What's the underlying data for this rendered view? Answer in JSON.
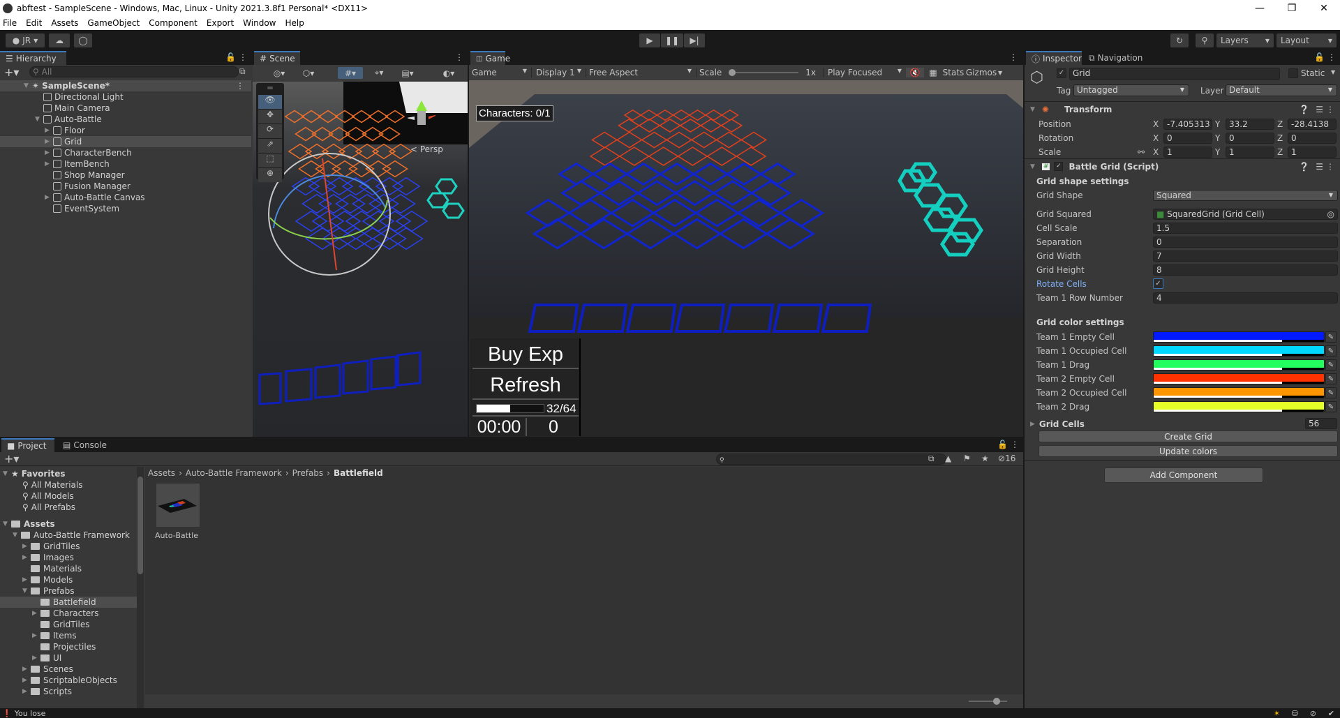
{
  "window": {
    "title": "abftest - SampleScene - Windows, Mac, Linux - Unity 2021.3.8f1 Personal* <DX11>",
    "controls": [
      "minimize",
      "maximize",
      "close"
    ]
  },
  "menu": [
    "File",
    "Edit",
    "Assets",
    "GameObject",
    "Component",
    "Export",
    "Window",
    "Help"
  ],
  "toolbar": {
    "account": "JR",
    "layers": "Layers",
    "layout": "Layout"
  },
  "hierarchy": {
    "tab": "Hierarchy",
    "search_placeholder": "All",
    "scene": "SampleScene*",
    "items": [
      {
        "label": "Directional Light",
        "depth": 1,
        "expand": false,
        "selected": false
      },
      {
        "label": "Main Camera",
        "depth": 1,
        "expand": false,
        "selected": false
      },
      {
        "label": "Auto-Battle",
        "depth": 1,
        "expand": "open",
        "selected": false
      },
      {
        "label": "Floor",
        "depth": 2,
        "expand": "closed",
        "selected": false
      },
      {
        "label": "Grid",
        "depth": 2,
        "expand": "closed",
        "selected": true
      },
      {
        "label": "CharacterBench",
        "depth": 2,
        "expand": "closed",
        "selected": false
      },
      {
        "label": "ItemBench",
        "depth": 2,
        "expand": "closed",
        "selected": false
      },
      {
        "label": "Shop Manager",
        "depth": 2,
        "expand": false,
        "selected": false
      },
      {
        "label": "Fusion Manager",
        "depth": 2,
        "expand": false,
        "selected": false
      },
      {
        "label": "Auto-Battle Canvas",
        "depth": 2,
        "expand": "closed",
        "selected": false
      },
      {
        "label": "EventSystem",
        "depth": 2,
        "expand": false,
        "selected": false
      }
    ]
  },
  "scene": {
    "tab": "Scene",
    "persp_label": "< Persp"
  },
  "game": {
    "tab": "Game",
    "mode": "Game",
    "display": "Display 1",
    "aspect": "Free Aspect",
    "scale_label": "Scale",
    "scale_value": "1x",
    "play_mode": "Play Focused",
    "stats": "Stats",
    "gizmos": "Gizmos",
    "characters": "Characters: 0/1",
    "buy_exp": "Buy Exp",
    "refresh": "Refresh",
    "exp_text": "32/64",
    "exp_fraction": 0.5,
    "timer": "00:00",
    "gold": "0"
  },
  "inspector": {
    "tabs": [
      "Inspector",
      "Navigation"
    ],
    "object_name": "Grid",
    "active": true,
    "static_label": "Static",
    "tag_label": "Tag",
    "tag": "Untagged",
    "layer_label": "Layer",
    "layer": "Default",
    "transform": {
      "title": "Transform",
      "rows": [
        {
          "label": "Position",
          "x": "-7.405313",
          "y": "33.2",
          "z": "-28.4138"
        },
        {
          "label": "Rotation",
          "x": "0",
          "y": "0",
          "z": "0"
        },
        {
          "label": "Scale",
          "x": "1",
          "y": "1",
          "z": "1"
        }
      ]
    },
    "script": {
      "title": "Battle Grid (Script)",
      "shape_header": "Grid shape settings",
      "fields": [
        {
          "label": "Grid Shape",
          "value": "Squared",
          "kind": "dropdown"
        },
        {
          "label": "Grid Squared",
          "value": "SquaredGrid (Grid Cell)",
          "kind": "object"
        },
        {
          "label": "Cell Scale",
          "value": "1.5",
          "kind": "text"
        },
        {
          "label": "Separation",
          "value": "0",
          "kind": "text"
        },
        {
          "label": "Grid Width",
          "value": "7",
          "kind": "text"
        },
        {
          "label": "Grid Height",
          "value": "8",
          "kind": "text"
        },
        {
          "label": "Rotate Cells",
          "value": "true",
          "kind": "checkbox"
        },
        {
          "label": "Team 1 Row Number",
          "value": "4",
          "kind": "text"
        }
      ],
      "color_header": "Grid color settings",
      "colors": [
        {
          "label": "Team 1 Empty Cell",
          "color": "#0019ff"
        },
        {
          "label": "Team 1 Occupied Cell",
          "color": "#00d8ff"
        },
        {
          "label": "Team 1 Drag",
          "color": "#22ff5e"
        },
        {
          "label": "Team 2 Empty Cell",
          "color": "#ff3200"
        },
        {
          "label": "Team 2 Occupied Cell",
          "color": "#ff9600"
        },
        {
          "label": "Team 2 Drag",
          "color": "#e5ff28"
        }
      ],
      "grid_cells_label": "Grid Cells",
      "grid_cells_count": "56",
      "create_grid": "Create Grid",
      "update_colors": "Update colors"
    },
    "add_component": "Add Component"
  },
  "project": {
    "tabs": [
      "Project",
      "Console"
    ],
    "hidden_count": "16",
    "favorites": {
      "label": "Favorites",
      "items": [
        "All Materials",
        "All Models",
        "All Prefabs"
      ]
    },
    "assets_label": "Assets",
    "tree": [
      {
        "label": "Auto-Battle Framework",
        "depth": 1,
        "expand": "open",
        "selected": false
      },
      {
        "label": "GridTiles",
        "depth": 2,
        "expand": "closed",
        "selected": false
      },
      {
        "label": "Images",
        "depth": 2,
        "expand": "closed",
        "selected": false
      },
      {
        "label": "Materials",
        "depth": 2,
        "expand": false,
        "selected": false
      },
      {
        "label": "Models",
        "depth": 2,
        "expand": "closed",
        "selected": false
      },
      {
        "label": "Prefabs",
        "depth": 2,
        "expand": "open",
        "selected": false
      },
      {
        "label": "Battlefield",
        "depth": 3,
        "expand": false,
        "selected": true
      },
      {
        "label": "Characters",
        "depth": 3,
        "expand": "closed",
        "selected": false
      },
      {
        "label": "GridTiles",
        "depth": 3,
        "expand": false,
        "selected": false
      },
      {
        "label": "Items",
        "depth": 3,
        "expand": "closed",
        "selected": false
      },
      {
        "label": "Projectiles",
        "depth": 3,
        "expand": false,
        "selected": false
      },
      {
        "label": "UI",
        "depth": 3,
        "expand": "closed",
        "selected": false
      },
      {
        "label": "Scenes",
        "depth": 2,
        "expand": "closed",
        "selected": false
      },
      {
        "label": "ScriptableObjects",
        "depth": 2,
        "expand": "closed",
        "selected": false
      },
      {
        "label": "Scripts",
        "depth": 2,
        "expand": "closed",
        "selected": false
      }
    ],
    "breadcrumb": [
      "Assets",
      "Auto-Battle Framework",
      "Prefabs",
      "Battlefield"
    ],
    "asset": "Auto-Battle"
  },
  "status": {
    "message": "You lose"
  }
}
